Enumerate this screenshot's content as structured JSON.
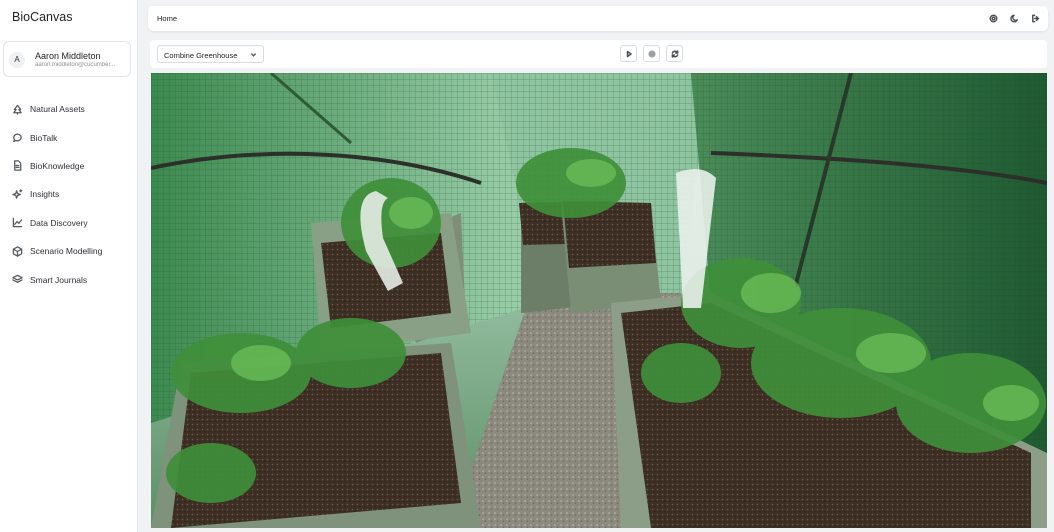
{
  "app": {
    "brand": "BioCanvas"
  },
  "user": {
    "initial": "A",
    "name": "Aaron Middleton",
    "email": "aaron.middleton@cucumber..."
  },
  "sidebar": {
    "items": [
      {
        "label": "Natural Assets",
        "icon": "tree-icon"
      },
      {
        "label": "BioTalk",
        "icon": "chat-icon"
      },
      {
        "label": "BioKnowledge",
        "icon": "document-icon"
      },
      {
        "label": "Insights",
        "icon": "sparkle-icon"
      },
      {
        "label": "Data Discovery",
        "icon": "chart-line-icon"
      },
      {
        "label": "Scenario Modelling",
        "icon": "cube-icon"
      },
      {
        "label": "Smart Journals",
        "icon": "layers-icon"
      }
    ]
  },
  "header": {
    "breadcrumb": "Home",
    "icons": [
      "settings-icon",
      "moon-icon",
      "logout-icon"
    ]
  },
  "toolbar": {
    "selected_site": "Combine Greenhouse",
    "controls": [
      "play-icon",
      "record-icon",
      "refresh-icon"
    ]
  },
  "viewport": {
    "content": "3D greenhouse scan",
    "colors": {
      "frame": "#2f6b3c",
      "soil": "#4a3a2c",
      "planter": "#7d8f77",
      "foliage": "#3f8f3a"
    }
  }
}
